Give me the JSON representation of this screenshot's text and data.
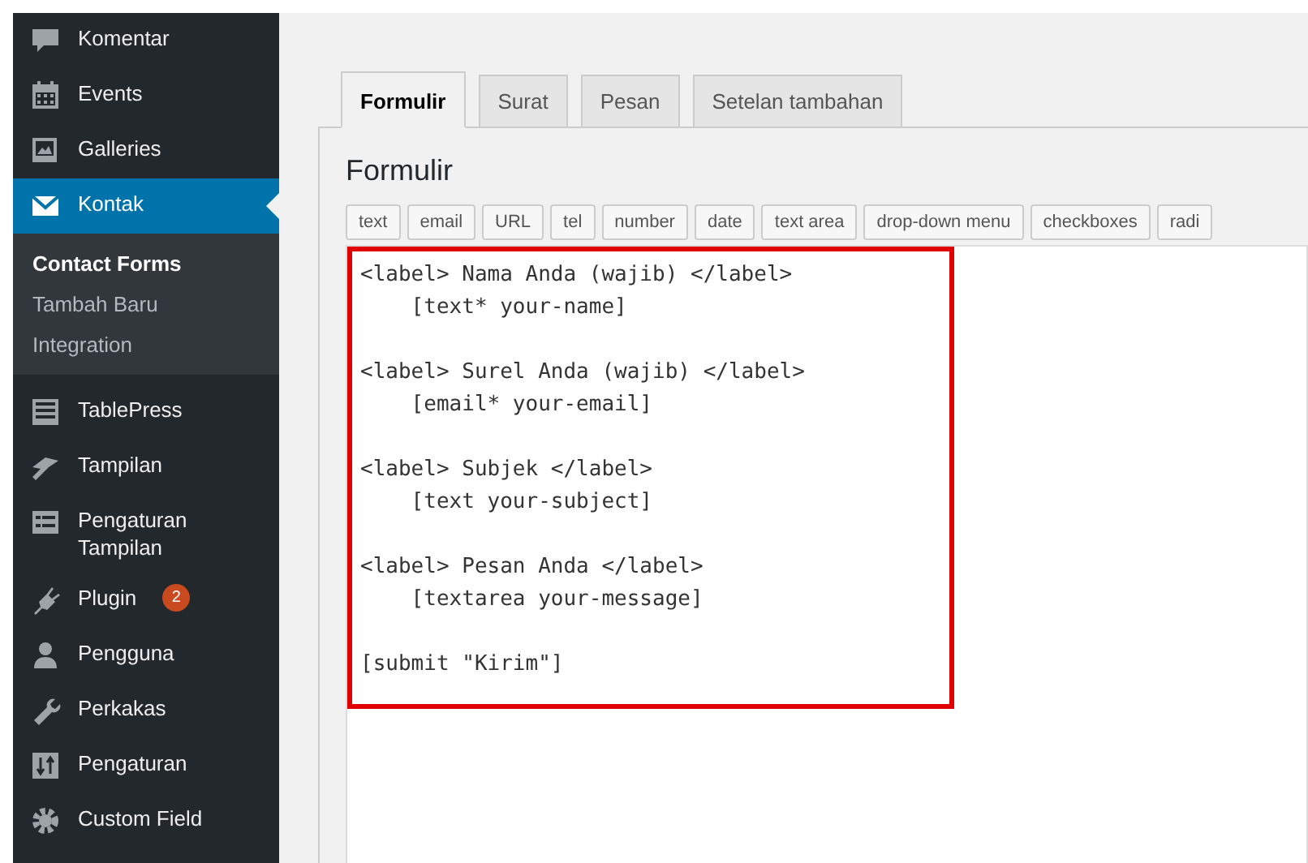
{
  "sidebar": {
    "items": [
      {
        "label": "Komentar",
        "selected": false
      },
      {
        "label": "Events",
        "selected": false
      },
      {
        "label": "Galleries",
        "selected": false
      },
      {
        "label": "Kontak",
        "selected": true,
        "children": [
          {
            "label": "Contact Forms",
            "selected": true
          },
          {
            "label": "Tambah Baru",
            "selected": false
          },
          {
            "label": "Integration",
            "selected": false
          }
        ]
      },
      {
        "label": "TablePress",
        "selected": false
      },
      {
        "label": "Tampilan",
        "selected": false
      },
      {
        "label": "Pengaturan Tampilan",
        "selected": false
      },
      {
        "label": "Plugin",
        "selected": false,
        "badge": "2"
      },
      {
        "label": "Pengguna",
        "selected": false
      },
      {
        "label": "Perkakas",
        "selected": false
      },
      {
        "label": "Pengaturan",
        "selected": false
      },
      {
        "label": "Custom Field",
        "selected": false
      }
    ]
  },
  "tabs": [
    {
      "label": "Formulir",
      "selected": true
    },
    {
      "label": "Surat",
      "selected": false
    },
    {
      "label": "Pesan",
      "selected": false
    },
    {
      "label": "Setelan tambahan",
      "selected": false
    }
  ],
  "panel": {
    "heading": "Formulir",
    "tag_buttons": [
      "text",
      "email",
      "URL",
      "tel",
      "number",
      "date",
      "text area",
      "drop-down menu",
      "checkboxes",
      "radi"
    ],
    "editor": {
      "value": "<label> Nama Anda (wajib) </label>\n    [text* your-name]\n\n<label> Surel Anda (wajib) </label>\n    [email* your-email]\n\n<label> Subjek </label>\n    [text your-subject]\n\n<label> Pesan Anda </label>\n    [textarea your-message]\n\n[submit \"Kirim\"]",
      "highlighted": true
    }
  }
}
